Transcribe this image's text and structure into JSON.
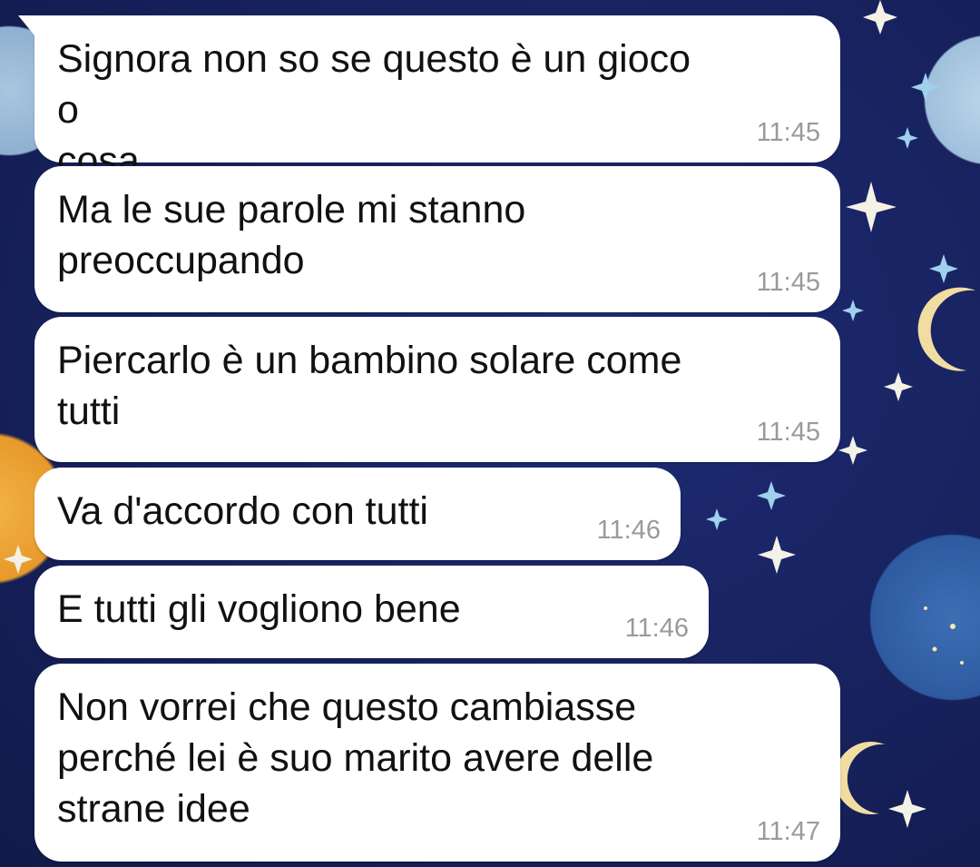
{
  "conversation": {
    "messages": [
      {
        "text": "Signora non so se questo è un gioco o\ncosa",
        "time": "11:45"
      },
      {
        "text": "Ma le sue parole mi stanno\npreoccupando",
        "time": "11:45"
      },
      {
        "text": "Piercarlo è un bambino solare come\ntutti",
        "time": "11:45"
      },
      {
        "text": "Va d'accordo con tutti",
        "time": "11:46"
      },
      {
        "text": "E tutti gli vogliono bene",
        "time": "11:46"
      },
      {
        "text": "Non vorrei che questo cambiasse\nperché lei è suo marito avere delle\nstrane idee",
        "time": "11:47"
      }
    ]
  },
  "theme": {
    "bubble_color": "#ffffff",
    "text_color": "#111111",
    "time_color": "#9a9a9a",
    "wallpaper_base": "#16205a"
  }
}
